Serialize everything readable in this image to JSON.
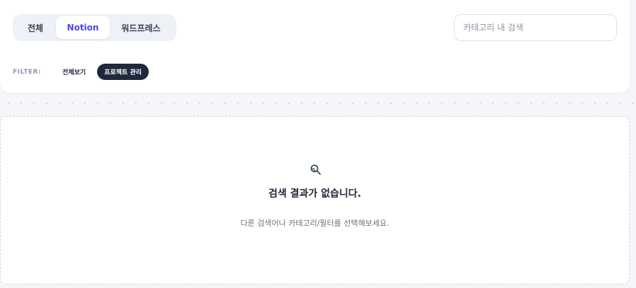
{
  "tabs": [
    {
      "label": "전체",
      "active": false
    },
    {
      "label": "Notion",
      "active": true
    },
    {
      "label": "워드프레스",
      "active": false
    }
  ],
  "search": {
    "placeholder": "카테고리 내 검색",
    "value": ""
  },
  "filter": {
    "label": "FILTER:",
    "chips": [
      {
        "label": "전체보기",
        "active": false
      },
      {
        "label": "프로젝트 관리",
        "active": true
      }
    ]
  },
  "empty_state": {
    "icon": "search-magnifier-icon",
    "title": "검색 결과가 없습니다.",
    "description": "다른 검색어나 카테고리/필터를 선택해보세요."
  },
  "colors": {
    "accent": "#4f46e5",
    "chip_active_bg": "#1e293b",
    "muted": "#8f9bb0"
  }
}
